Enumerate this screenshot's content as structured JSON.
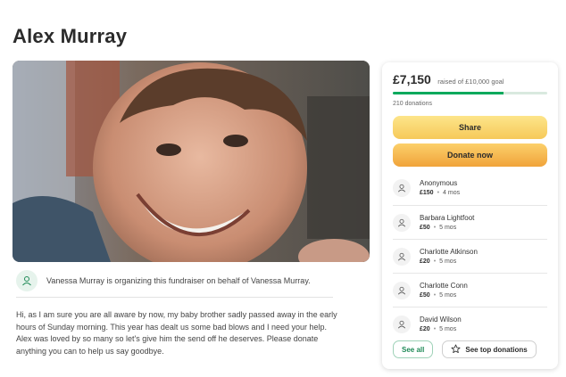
{
  "page": {
    "title": "Alex Murray"
  },
  "hero": {
    "image": "fundraiser-photo"
  },
  "organizer": {
    "icon": "person-icon",
    "text": "Vanessa Murray is organizing this fundraiser on behalf of Vanessa Murray."
  },
  "story": {
    "text": "Hi, as I am sure you are all aware by now, my baby brother sadly passed away in the early hours of Sunday morning. This year has dealt us some bad blows and I need your help. Alex was loved by so many so let's give him the send off he deserves. Please donate anything you can to help us say goodbye."
  },
  "donation_card": {
    "raised_amount": "£7,150",
    "raised_label": "raised of £10,000 goal",
    "progress_fraction": 0.715,
    "donation_count": "210 donations",
    "share_label": "Share",
    "donate_label": "Donate now",
    "donors": [
      {
        "name": "Anonymous",
        "amount": "£150",
        "time": "4 mos"
      },
      {
        "name": "Barbara Lightfoot",
        "amount": "£50",
        "time": "5 mos"
      },
      {
        "name": "Charlotte Atkinson",
        "amount": "£20",
        "time": "5 mos"
      },
      {
        "name": "Charlotte Conn",
        "amount": "£50",
        "time": "5 mos"
      },
      {
        "name": "David Wilson",
        "amount": "£20",
        "time": "5 mos"
      }
    ],
    "see_all_label": "See all",
    "top_donations_label": "See top donations",
    "top_donations_icon": "star-icon"
  },
  "colors": {
    "accent_green": "#02a95c",
    "share_yellow": "#f6c95a",
    "donate_orange": "#f0a33a"
  }
}
